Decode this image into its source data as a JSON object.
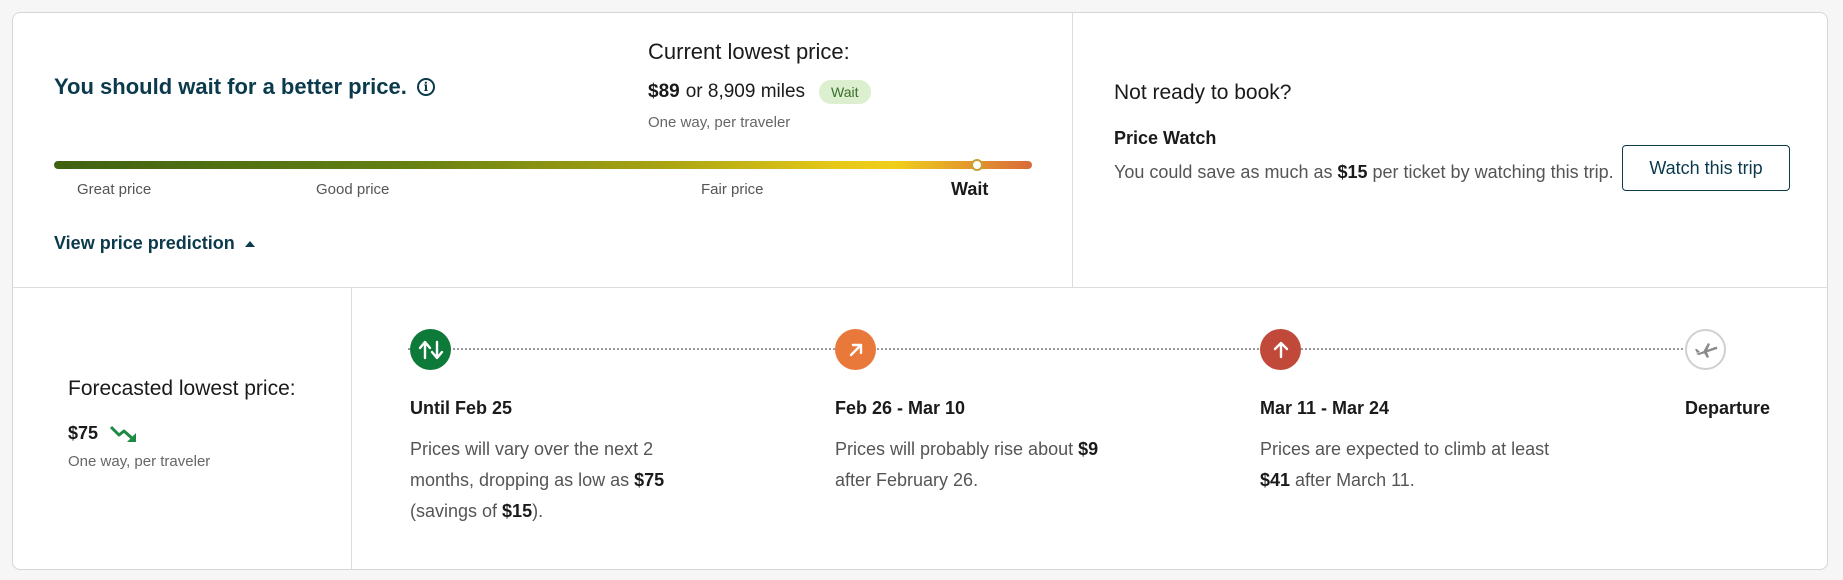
{
  "summary": {
    "headline": "You should wait for a better price.",
    "info_icon": "info-icon"
  },
  "current": {
    "title": "Current lowest price:",
    "price": "$89",
    "or_text": "or 8,909 miles",
    "badge": "Wait",
    "sub": "One way, per traveler"
  },
  "price_bar": {
    "labels": [
      "Great price",
      "Good price",
      "Fair price",
      "Wait"
    ],
    "active_label": "Wait",
    "colors": [
      "#3f6212",
      "#a8a312",
      "#efcf1a",
      "#d96a3a"
    ]
  },
  "prediction_link": {
    "label": "View price prediction",
    "icon": "caret-up-icon"
  },
  "price_watch": {
    "not_ready": "Not ready to book?",
    "title": "Price Watch",
    "desc_pre": "You could save as much as ",
    "desc_amount": "$15",
    "desc_post": " per ticket by watching this trip.",
    "button": "Watch this trip"
  },
  "forecast": {
    "title": "Forecasted lowest price:",
    "price": "$75",
    "trend_icon": "trending-down-icon",
    "sub": "One way, per traveler"
  },
  "timeline": [
    {
      "title": "Until Feb 25",
      "icon": "arrows-up-down-icon",
      "color": "#0e7a3a",
      "desc_parts": [
        {
          "text": "Prices will vary over the next 2 months, dropping as low as ",
          "bold": false
        },
        {
          "text": "$75",
          "bold": true
        },
        {
          "text": " (savings of ",
          "bold": false
        },
        {
          "text": "$15",
          "bold": true
        },
        {
          "text": ").",
          "bold": false
        }
      ]
    },
    {
      "title": "Feb 26 - Mar 10",
      "icon": "arrow-up-right-icon",
      "color": "#e8793a",
      "desc_parts": [
        {
          "text": "Prices will probably rise about ",
          "bold": false
        },
        {
          "text": "$9",
          "bold": true
        },
        {
          "text": " after February 26.",
          "bold": false
        }
      ]
    },
    {
      "title": "Mar 11 - Mar 24",
      "icon": "arrow-up-icon",
      "color": "#c0493a",
      "desc_parts": [
        {
          "text": "Prices are expected to climb at least ",
          "bold": false
        },
        {
          "text": "$41",
          "bold": true
        },
        {
          "text": " after March 11.",
          "bold": false
        }
      ]
    },
    {
      "title": "Departure",
      "icon": "airplane-icon",
      "color": "#ffffff",
      "desc_parts": []
    }
  ]
}
